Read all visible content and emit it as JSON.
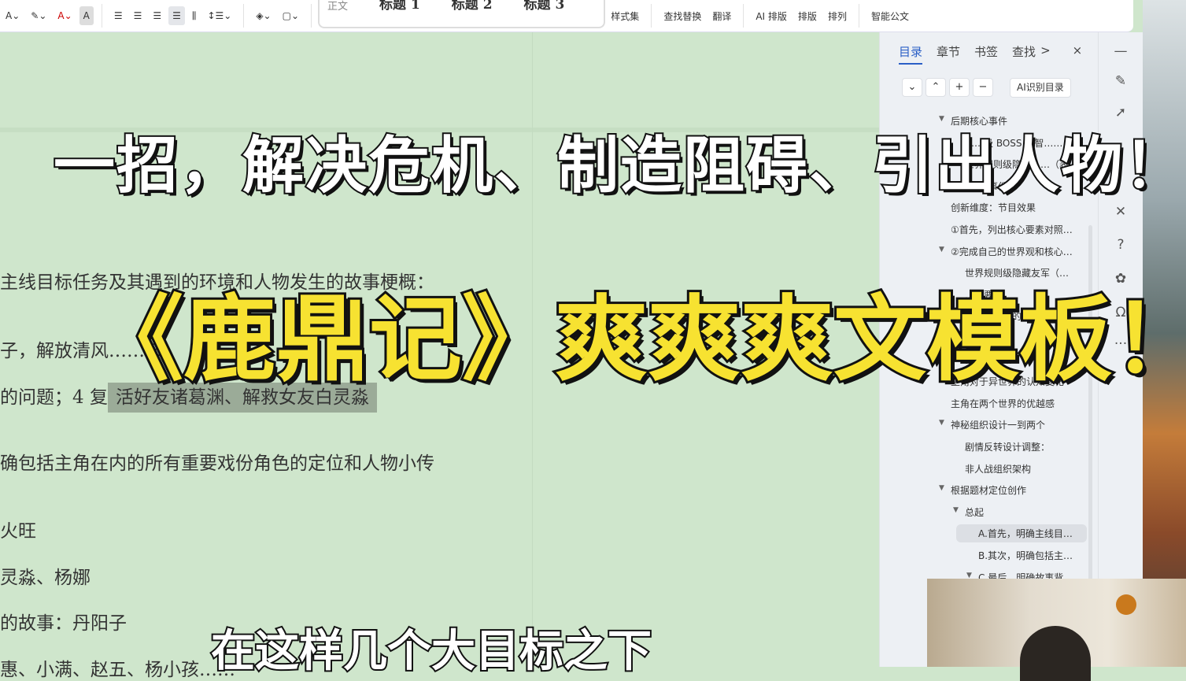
{
  "toolbar": {
    "style_normal": "正文",
    "heading1": "标题 1",
    "heading2": "标题 2",
    "heading3": "标题 3",
    "style_set": "样式集",
    "find_replace": "查找替换",
    "translate": "翻译",
    "ai_layout": "AI 排版",
    "layout": "排版",
    "arrange": "排列",
    "smart_doc": "智能公文"
  },
  "doc": {
    "lines": [
      "主线目标任务及其遇到的环境和人物发生的故事梗概：",
      "子，解放清风…… 3、",
      "的问题；4 复",
      "活好友诸葛渊、解救女友白灵淼",
      "确包括主角在内的所有重要戏份角色的定位和人物小传",
      "火旺",
      "灵淼、杨娜",
      "的故事：丹阳子",
      "惠、小满、赵五、杨小孩……"
    ]
  },
  "panel": {
    "tabs": [
      "目录",
      "章节",
      "书签",
      "查找"
    ],
    "more": ">",
    "close": "×",
    "btn_down": "⌄",
    "btn_up": "⌃",
    "btn_add": "+",
    "btn_remove": "−",
    "ai_toc": "AI识别目录",
    "outline": [
      "后期核心事件",
      "……级 BOSS 大智……",
      "世界规则级隐藏……（表",
      "中期核心事件",
      "创新维度：节目效果",
      "①首先，列出核心要素对照…",
      "②完成自己的世界观和核心…",
      "世界规则级隐藏友军（…",
      "……要…",
      "……据……的…",
      "……",
      "……两……",
      "主角对于异世界的认知变化",
      "主角在两个世界的优越感",
      "神秘组织设计一到两个",
      "剧情反转设计调整：",
      "非人战组织架构",
      "根据题材定位创作",
      "总起",
      "A.首先，明确主线目…",
      "B.其次，明确包括主…",
      "C.最后，明确故事背…"
    ]
  },
  "overlay": {
    "title_line1": "一招，解决危机、制造阻碍、引出人物！",
    "title_line2": "《鹿鼎记》爽爽爽文模板！",
    "subtitle": "在这样几个大目标之下"
  }
}
